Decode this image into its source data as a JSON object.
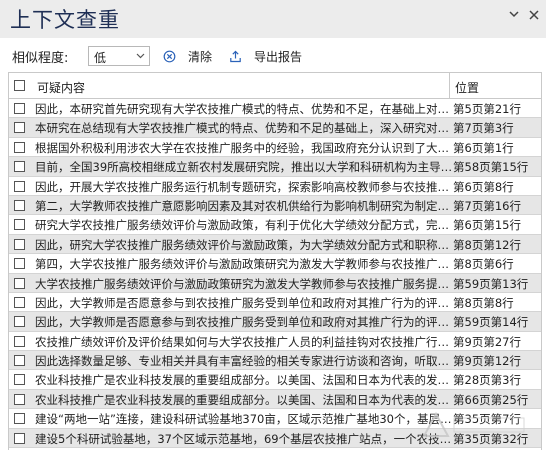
{
  "window": {
    "title": "上下文查重",
    "menu_icon": "menu-down-icon",
    "close_icon": "close-icon"
  },
  "toolbar": {
    "similarity_label": "相似程度:",
    "similarity_value": "低",
    "clear_label": "清除",
    "export_label": "导出报告",
    "accent_color": "#2b62b8"
  },
  "table": {
    "headers": {
      "content": "可疑内容",
      "location": "位置"
    },
    "rows": [
      {
        "content": "因此，本研究首先研究现有大学农技推广模式的特点、优势和不足，在基础上对大...",
        "location": "第5页第21行"
      },
      {
        "content": "本研究在总结现有大学农技推广模式的特点、优势和不足的基础上，深入研究对大...",
        "location": "第7页第3行"
      },
      {
        "content": "根据国外积极利用涉农大学在农技推广服务中的经验，我国政府充分认识到了大学...",
        "location": "第6页第1行"
      },
      {
        "content": "目前，全国39所高校相继成立新农村发展研究院，推出以大学和科研机构为主导的...",
        "location": "第58页第15行"
      },
      {
        "content": "因此，开展大学农技推广服务运行机制专题研究，探索影响高校教师参与农技推广...",
        "location": "第6页第8行"
      },
      {
        "content": "第二，大学教师农技推广意愿影响因素及其对农机供给行为影响机制研究为制定促...",
        "location": "第7页第16行"
      },
      {
        "content": "研究大学农技推广服务绩效评价与激励政策，有利于优化大学绩效分配方式，完善...",
        "location": "第6页第15行"
      },
      {
        "content": "因此，研究大学农技推广服务绩效评价与激励政策，为大学绩效分配方式和职称评...",
        "location": "第8页第12行"
      },
      {
        "content": "第四，大学农技推广服务绩效评价与激励政策研究为激发大学教师参与农技推广服...",
        "location": "第8页第6行"
      },
      {
        "content": "大学农技推广服务绩效评价与激励政策研究为激发大学教师参与农技推广服务提供...",
        "location": "第59页第13行"
      },
      {
        "content": "因此，大学教师是否愿意参与到农技推广服务受到单位和政府对其推广行为的评价...",
        "location": "第8页第8行"
      },
      {
        "content": "因此，大学教师是否愿意参与到农技推广服务受到单位和政府对其推广行为的评价...",
        "location": "第59页第14行"
      },
      {
        "content": "农技推广绩效评价及评价结果如何与大学农技推广人员的利益挂钩对农技推广行为的...",
        "location": "第9页第27行"
      },
      {
        "content": "因此选择数量足够、专业相关并具有丰富经验的相关专家进行访谈和咨询，听取专...",
        "location": "第9页第12行"
      },
      {
        "content": "农业科技推广是农业科技发展的重要组成部分。以美国、法国和日本为代表的发达...",
        "location": "第28页第3行"
      },
      {
        "content": "农业科技推广是农业科技发展的重要组成部分。以美国、法国和日本为代表的发达...",
        "location": "第66页第25行"
      },
      {
        "content": "建设“两地一站”连接，建设科研试验基地370亩，区域示范推广基地30个，基层农技...",
        "location": "第35页第7行"
      },
      {
        "content": "建设5个科研试验基地，37个区域示范基地，69个基层农技推广站点，一个农技推广...",
        "location": "第35页第32行"
      }
    ]
  }
}
